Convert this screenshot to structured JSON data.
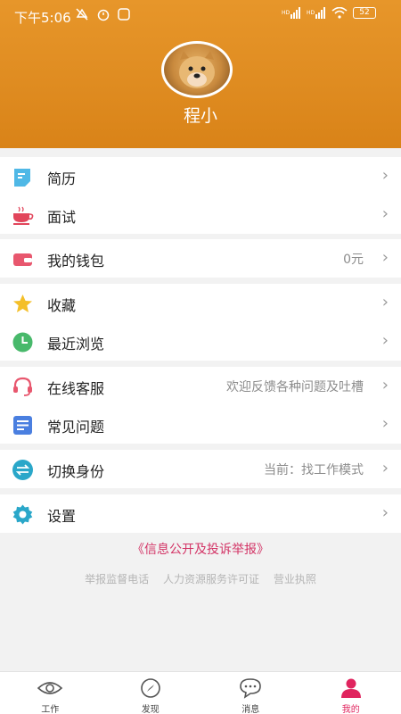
{
  "status_bar": {
    "time": "下午5:06",
    "battery": "52"
  },
  "profile": {
    "name": "程小"
  },
  "menu": {
    "resume": {
      "label": "简历"
    },
    "interview": {
      "label": "面试"
    },
    "wallet": {
      "label": "我的钱包",
      "extra": "0元"
    },
    "favorites": {
      "label": "收藏"
    },
    "recent": {
      "label": "最近浏览"
    },
    "service": {
      "label": "在线客服",
      "extra": "欢迎反馈各种问题及吐槽"
    },
    "faq": {
      "label": "常见问题"
    },
    "switch_identity": {
      "label": "切换身份",
      "extra": "当前：找工作模式"
    },
    "settings": {
      "label": "设置"
    }
  },
  "footer": {
    "complaint_link": "《信息公开及投诉举报》",
    "info": [
      "举报监督电话",
      "人力资源服务许可证",
      "营业执照"
    ]
  },
  "tabs": [
    {
      "label": "工作",
      "icon": "eye-icon"
    },
    {
      "label": "发现",
      "icon": "compass-icon"
    },
    {
      "label": "消息",
      "icon": "chat-icon"
    },
    {
      "label": "我的",
      "icon": "person-icon"
    }
  ],
  "colors": {
    "accent": "#e0245e",
    "header": "#e08d22"
  }
}
